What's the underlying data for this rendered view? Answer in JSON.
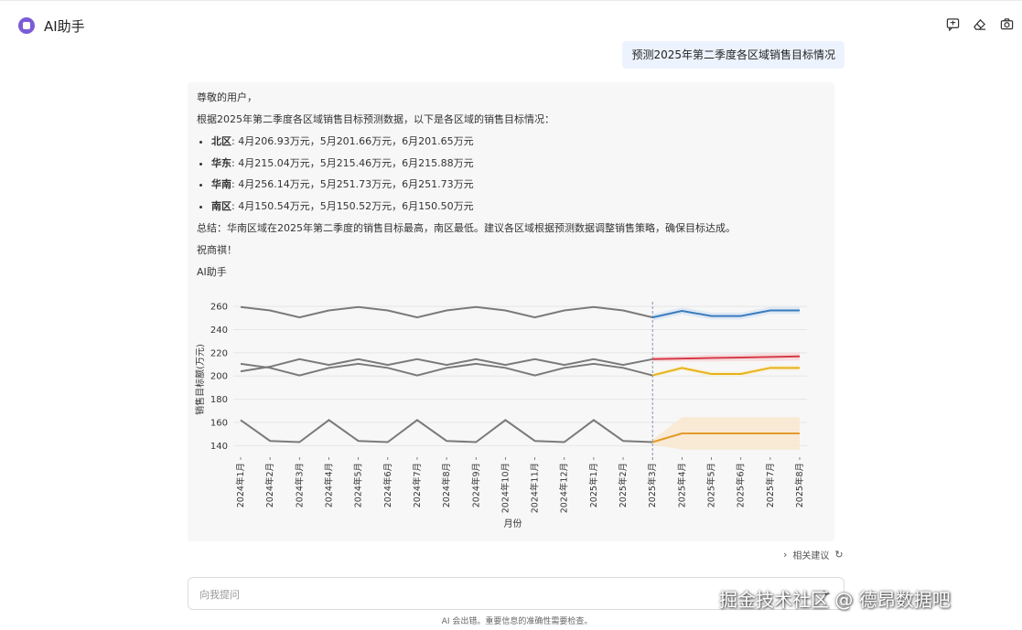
{
  "app": {
    "title": "AI助手"
  },
  "toolbar": {
    "icons": [
      "chat-bubble-icon",
      "eraser-icon",
      "camera-icon"
    ]
  },
  "user_message": "预测2025年第二季度各区域销售目标情况",
  "answer": {
    "greeting": "尊敬的用户，",
    "intro": "根据2025年第二季度各区域销售目标预测数据，以下是各区域的销售目标情况：",
    "items": [
      {
        "region": "北区",
        "text": ": 4月206.93万元，5月201.66万元，6月201.65万元"
      },
      {
        "region": "华东",
        "text": ": 4月215.04万元，5月215.46万元，6月215.88万元"
      },
      {
        "region": "华南",
        "text": ": 4月256.14万元，5月251.73万元，6月251.73万元"
      },
      {
        "region": "南区",
        "text": ": 4月150.54万元，5月150.52万元，6月150.50万元"
      }
    ],
    "summary": "总结：华南区域在2025年第二季度的销售目标最高，南区最低。建议各区域根据预测数据调整销售策略，确保目标达成。",
    "closing": "祝商祺！",
    "signature": "AI助手"
  },
  "chart_data": {
    "type": "line",
    "xlabel": "月份",
    "ylabel": "销售目标额(万元)",
    "categories": [
      "2024年1月",
      "2024年2月",
      "2024年3月",
      "2024年4月",
      "2024年5月",
      "2024年6月",
      "2024年7月",
      "2024年8月",
      "2024年9月",
      "2024年10月",
      "2024年11月",
      "2024年12月",
      "2025年1月",
      "2025年2月",
      "2025年3月",
      "2025年4月",
      "2025年5月",
      "2025年6月",
      "2025年7月",
      "2025年8月"
    ],
    "ylim": [
      130,
      264
    ],
    "yticks": [
      140,
      160,
      180,
      200,
      220,
      240,
      260
    ],
    "grid": true,
    "forecast_start": "2025年3月",
    "series": [
      {
        "history": [
          259.5,
          256.5,
          250.5,
          256.5,
          259.5,
          256.5,
          250.5,
          256.5,
          259.5,
          256.5,
          250.5,
          256.5,
          259.5,
          256.5,
          250.5
        ],
        "forecast": [
          250.5,
          256.1,
          251.7,
          251.7,
          256.5,
          256.5
        ],
        "band": [
          3,
          3,
          3,
          3,
          3,
          3
        ],
        "forecast_color": "#3a7bbd",
        "band_color": "#dbe6f3"
      },
      {
        "history": [
          204,
          208,
          214.5,
          209.5,
          214.5,
          209.5,
          214.5,
          209.5,
          214.5,
          209.5,
          214.5,
          209.5,
          214.5,
          209.5,
          214.5
        ],
        "forecast": [
          214.5,
          215,
          215.5,
          215.9,
          216.4,
          216.9
        ],
        "band": [
          2,
          2.5,
          3,
          3,
          3.5,
          3.5
        ],
        "forecast_color": "#d63a46",
        "band_color": "#f6d8da"
      },
      {
        "history": [
          210.5,
          207,
          200.5,
          207,
          210.5,
          207,
          200.5,
          207,
          210.5,
          207,
          200.5,
          207,
          210.5,
          207,
          200.5
        ],
        "forecast": [
          200.5,
          206.9,
          201.7,
          201.7,
          207,
          207
        ],
        "band": [
          1.5,
          2,
          2,
          2,
          2,
          2
        ],
        "forecast_color": "#e6b318",
        "band_color": "#f9efd2"
      },
      {
        "history": [
          162,
          144,
          143,
          162,
          144,
          143,
          162,
          144,
          143,
          162,
          144,
          143,
          162,
          144,
          143
        ],
        "forecast": [
          143,
          150.5,
          150.5,
          150.5,
          150.5,
          150.5
        ],
        "band": [
          2,
          14,
          14,
          14,
          14,
          14
        ],
        "forecast_color": "#e39a2a",
        "band_color": "#f9e7cf"
      }
    ],
    "history_color": "#7a7a7a"
  },
  "suggestions": {
    "label": "相关建议"
  },
  "input": {
    "placeholder": "向我提问",
    "value": ""
  },
  "disclaimer": "AI 会出错。重要信息的准确性需要检查。",
  "watermark": "掘金技术社区 @ 德昂数据吧"
}
